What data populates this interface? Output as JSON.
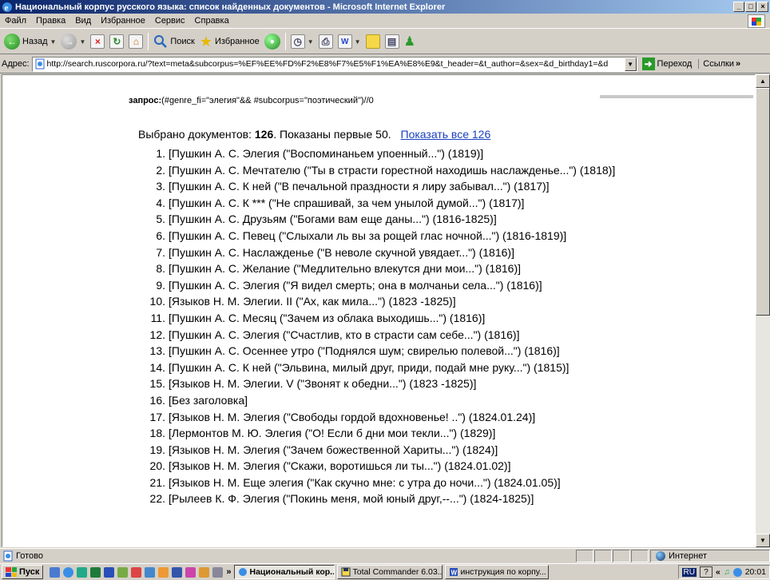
{
  "window": {
    "title": "Национальный корпус русского языка: список найденных документов - Microsoft Internet Explorer",
    "minimize": "_",
    "maximize": "□",
    "close": "×"
  },
  "menu": [
    "Файл",
    "Правка",
    "Вид",
    "Избранное",
    "Сервис",
    "Справка"
  ],
  "toolbar": {
    "back_label": "Назад",
    "search_label": "Поиск",
    "favorites_label": "Избранное"
  },
  "address": {
    "label": "Адрес:",
    "url": "http://search.ruscorpora.ru/?text=meta&subcorpus=%EF%EE%FD%F2%E8%F7%E5%F1%EA%E8%E9&t_header=&t_author=&sex=&d_birthday1=&d",
    "go_label": "Переход",
    "links_label": "Ссылки"
  },
  "page": {
    "query_label": "запрос:",
    "query_text": "(#genre_fi=\"элегия\"&& #subcorpus=\"поэтический\")//0",
    "summary_prefix": "Выбрано документов:",
    "summary_count": "126",
    "summary_suffix": ". Показаны первые 50.",
    "show_all_link": "Показать все 126",
    "documents": [
      {
        "num": "1.",
        "text": "[Пушкин А. С. Элегия (\"Воспоминаньем упоенный...\") (1819)]"
      },
      {
        "num": "2.",
        "text": "[Пушкин А. С. Мечтателю (\"Ты в страсти горестной находишь наслажденье...\") (1818)]"
      },
      {
        "num": "3.",
        "text": "[Пушкин А. С. К ней (\"В печальной праздности я лиру забывал...\") (1817)]"
      },
      {
        "num": "4.",
        "text": "[Пушкин А. С. К *** (\"Не спрашивай, за чем унылой думой...\") (1817)]"
      },
      {
        "num": "5.",
        "text": "[Пушкин А. С. Друзьям (\"Богами вам еще даны...\") (1816-1825)]"
      },
      {
        "num": "6.",
        "text": "[Пушкин А. С. Певец (\"Слыхали ль вы за рощей глас ночной...\") (1816-1819)]"
      },
      {
        "num": "7.",
        "text": "[Пушкин А. С. Наслажденье (\"В неволе скучной увядает...\") (1816)]"
      },
      {
        "num": "8.",
        "text": "[Пушкин А. С. Желание (\"Медлительно влекутся дни мои...\") (1816)]"
      },
      {
        "num": "9.",
        "text": "[Пушкин А. С. Элегия (\"Я видел смерть; она в молчаньи села...\") (1816)]"
      },
      {
        "num": "10.",
        "text": "[Языков Н. М. Элегии. II (\"Ах, как мила...\") (1823 -1825)]"
      },
      {
        "num": "11.",
        "text": "[Пушкин А. С. Месяц (\"Зачем из облака выходишь...\") (1816)]"
      },
      {
        "num": "12.",
        "text": "[Пушкин А. С. Элегия (\"Счастлив, кто в страсти сам себе...\") (1816)]"
      },
      {
        "num": "13.",
        "text": "[Пушкин А. С. Осеннее утро (\"Поднялся шум; свирелью полевой...\") (1816)]"
      },
      {
        "num": "14.",
        "text": "[Пушкин А. С. К ней (\"Эльвина, милый друг, приди, подай мне руку...\") (1815)]"
      },
      {
        "num": "15.",
        "text": "[Языков Н. М. Элегии. V (\"Звонят к обедни...\") (1823 -1825)]"
      },
      {
        "num": "16.",
        "text": "[Без заголовка]"
      },
      {
        "num": "17.",
        "text": "[Языков Н. М. Элегия (\"Свободы гордой вдохновенье! ..\") (1824.01.24)]"
      },
      {
        "num": "18.",
        "text": "[Лермонтов М. Ю. Элегия (\"О! Если б дни мои текли...\") (1829)]"
      },
      {
        "num": "19.",
        "text": "[Языков Н. М. Элегия (\"Зачем божественной Хариты...\") (1824)]"
      },
      {
        "num": "20.",
        "text": "[Языков Н. М. Элегия (\"Скажи, воротишься ли ты...\") (1824.01.02)]"
      },
      {
        "num": "21.",
        "text": "[Языков Н. М. Еще элегия (\"Как скучно мне: с утра до ночи...\") (1824.01.05)]"
      },
      {
        "num": "22.",
        "text": "[Рылеев К. Ф. Элегия (\"Покинь меня, мой юный друг,--...\") (1824-1825)]"
      }
    ]
  },
  "status": {
    "text": "Готово",
    "zone": "Интернет"
  },
  "taskbar": {
    "start_label": "Пуск",
    "more": "»",
    "tasks": [
      {
        "label": "Национальный кор...",
        "active": true
      },
      {
        "label": "Total Commander 6.03...",
        "active": false
      },
      {
        "label": "инструкция по корпу...",
        "active": false
      }
    ],
    "lang": "RU",
    "help": "?",
    "tray_more": "«",
    "time": "20:01"
  },
  "colors": {
    "title_gradient_start": "#0a246a",
    "link": "#1a3fbf",
    "chrome": "#d4d0c8"
  }
}
